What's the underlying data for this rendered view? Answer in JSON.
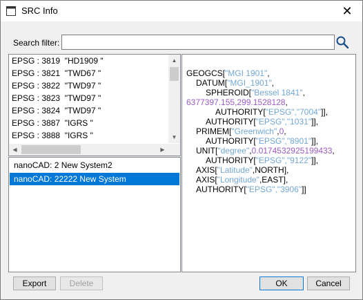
{
  "window": {
    "title": "SRC Info",
    "close_label": "✕"
  },
  "search": {
    "label": "Search filter:",
    "value": "",
    "placeholder": ""
  },
  "src_list": {
    "items": [
      "EPSG : 3819  \"HD1909 \"",
      "EPSG : 3821  \"TWD67 \"",
      "EPSG : 3822  \"TWD97 \"",
      "EPSG : 3823  \"TWD97 \"",
      "EPSG : 3824  \"TWD97 \"",
      "EPSG : 3887  \"IGRS \"",
      "EPSG : 3888  \"IGRS \""
    ]
  },
  "user_list": {
    "items": [
      {
        "label": "nanoCAD: 2 New System2",
        "selected": false
      },
      {
        "label": "nanoCAD: 22222 New System",
        "selected": true
      }
    ]
  },
  "wkt": {
    "l1_kw": "GEOGCS[",
    "l1_str": "\"MGI 1901\"",
    "l1_end": ",",
    "l2_kw": "DATUM[",
    "l2_str": "\"MGI_1901\"",
    "l2_end": ",",
    "l3_kw": "SPHEROID[",
    "l3_str": "\"Bessel 1841\"",
    "l3_end": ",",
    "l4_num": "6377397.155,299.1528128",
    "l4_end": ",",
    "l5_kw": "AUTHORITY[",
    "l5_str": "\"EPSG\",\"7004\"",
    "l5_end": "]],",
    "l6_kw": "AUTHORITY[",
    "l6_str": "\"EPSG\",\"1031\"",
    "l6_end": "]],",
    "l7_kw": "PRIMEM[",
    "l7_str": "\"Greenwich\"",
    "l7_sep": ",",
    "l7_num": "0",
    "l7_end": ",",
    "l8_kw": "AUTHORITY[",
    "l8_str": "\"EPSG\",\"8901\"",
    "l8_end": "]],",
    "l9_kw": "UNIT[",
    "l9_str": "\"degree\"",
    "l9_sep": ",",
    "l9_num": "0.0174532925199433",
    "l9_end": ",",
    "l10_kw": "AUTHORITY[",
    "l10_str": "\"EPSG\",\"9122\"",
    "l10_end": "]],",
    "l11_kw": "AXIS[",
    "l11_str": "\"Latitude\"",
    "l11_end": ",NORTH],",
    "l12_kw": "AXIS[",
    "l12_str": "\"Longitude\"",
    "l12_end": ",EAST],",
    "l13_kw": "AUTHORITY[",
    "l13_str": "\"EPSG\",\"3906\"",
    "l13_end": "]]"
  },
  "buttons": {
    "export": "Export",
    "delete": "Delete",
    "ok": "OK",
    "cancel": "Cancel"
  },
  "colors": {
    "accent": "#0078d7",
    "wkt_string": "#72a7d4",
    "wkt_number": "#9b5cc6"
  },
  "icons": {
    "app": "window-icon",
    "search": "magnifier-icon"
  }
}
